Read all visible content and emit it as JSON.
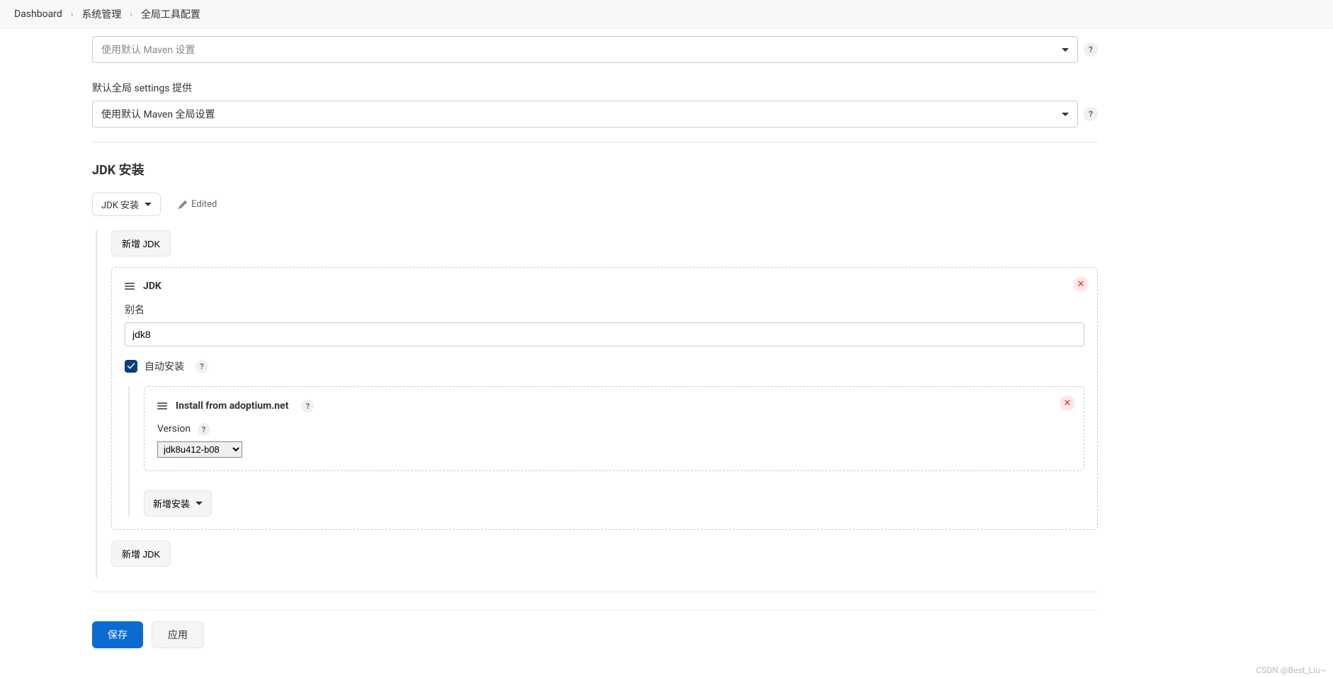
{
  "breadcrumb": {
    "items": [
      "Dashboard",
      "系统管理",
      "全局工具配置"
    ]
  },
  "maven": {
    "settings_select_faded": "使用默认 Maven 设置",
    "global_settings_label": "默认全局 settings 提供",
    "global_settings_select": "使用默认 Maven 全局设置"
  },
  "jdk": {
    "section_title": "JDK 安装",
    "section_button": "JDK 安装",
    "edited_label": "Edited",
    "add_button_top": "新增 JDK",
    "add_button_bottom": "新增 JDK",
    "item": {
      "title": "JDK",
      "alias_label": "别名",
      "alias_value": "jdk8",
      "auto_install_label": "自动安装",
      "auto_install_checked": true,
      "installer": {
        "title": "Install from adoptium.net",
        "version_label": "Version",
        "version_value": "jdk8u412-b08"
      },
      "add_installer_label": "新增安装"
    }
  },
  "footer": {
    "save": "保存",
    "apply": "应用"
  },
  "watermark": "CSDN @Best_Liu~"
}
